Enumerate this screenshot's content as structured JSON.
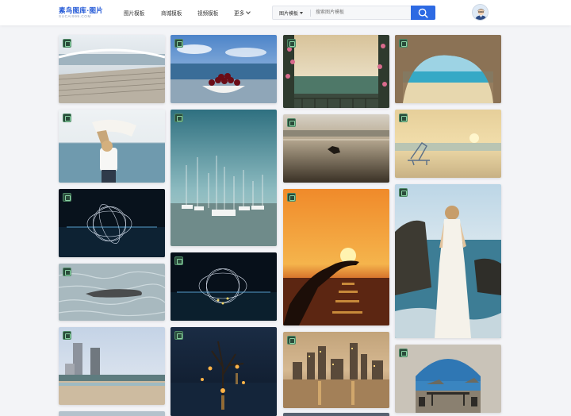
{
  "header": {
    "logo_text": "素鸟图库·图片",
    "logo_domain": "SUCAI999.COM",
    "nav": [
      "图片模板",
      "商城模板",
      "视频模板",
      "更多"
    ],
    "search_category": "图片模板",
    "search_placeholder": "搜索图片模板"
  },
  "gallery": {
    "tiles": [
      {
        "name": "photo-boardwalk-sea",
        "icon": "image-badge-icon"
      },
      {
        "name": "photo-cherries-bowl",
        "icon": "image-badge-icon"
      },
      {
        "name": "photo-balcony-sunset-flowers",
        "icon": "image-badge-icon"
      },
      {
        "name": "photo-sea-cave-beach",
        "icon": "image-badge-icon"
      },
      {
        "name": "photo-woman-scarf-beach",
        "icon": "image-badge-icon"
      },
      {
        "name": "photo-marina-sailboats",
        "icon": "image-badge-icon"
      },
      {
        "name": "photo-beach-dog-sunset",
        "icon": "image-badge-icon"
      },
      {
        "name": "photo-beach-chair-sunset",
        "icon": "image-badge-icon"
      },
      {
        "name": "photo-light-painting",
        "icon": "image-badge-icon"
      },
      {
        "name": "photo-hand-holding-sun",
        "icon": "image-badge-icon"
      },
      {
        "name": "photo-woman-white-dress-rocks",
        "icon": "image-badge-icon"
      },
      {
        "name": "photo-seal-in-water",
        "icon": "image-badge-icon"
      },
      {
        "name": "photo-light-painting-2",
        "icon": "image-badge-icon"
      },
      {
        "name": "photo-city-beach-towers",
        "icon": "image-badge-icon"
      },
      {
        "name": "photo-lantern-tree-night",
        "icon": "image-badge-icon"
      },
      {
        "name": "photo-city-skyline-dusk",
        "icon": "image-badge-icon"
      },
      {
        "name": "photo-terrace-arch-sea",
        "icon": "image-badge-icon"
      }
    ]
  },
  "colors": {
    "accent": "#2d6ae3",
    "logo": "#1f56d6",
    "page_bg": "#f3f4f7"
  }
}
